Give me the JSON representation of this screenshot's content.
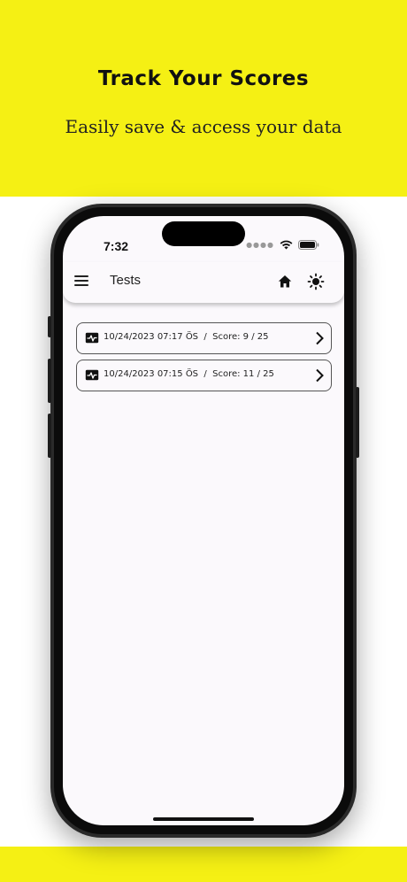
{
  "promo": {
    "headline": "Track Your Scores",
    "subline": "Easily save & access your data"
  },
  "status_bar": {
    "time": "7:32",
    "icons": [
      "cellular-dots-icon",
      "wifi-icon",
      "battery-icon"
    ]
  },
  "app_bar": {
    "title": "Tests",
    "icons": [
      "menu-icon",
      "home-icon",
      "brightness-icon"
    ]
  },
  "tests": [
    {
      "datetime": "10/24/2023 07:17 ÖS",
      "separator": "/",
      "score_label": "Score: 9 / 25",
      "icon": "activity-icon"
    },
    {
      "datetime": "10/24/2023 07:15 ÖS",
      "separator": "/",
      "score_label": "Score: 11 / 25",
      "icon": "activity-icon"
    }
  ],
  "colors": {
    "banner": "#f5f014",
    "screen_background": "#fbf9fc",
    "text": "#222222"
  }
}
